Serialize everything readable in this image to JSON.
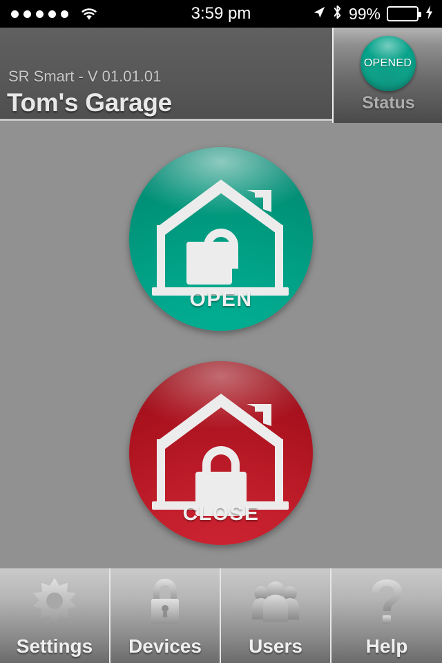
{
  "statusbar": {
    "signal_dots": 5,
    "wifi_icon": "wifi-icon",
    "time": "3:59 pm",
    "location_icon": "location-arrow-icon",
    "bluetooth_icon": "bluetooth-icon",
    "battery_percent": "99%",
    "battery_color": "#3ddb52",
    "charging_icon": "lightning-bolt-icon"
  },
  "header": {
    "version": "SR Smart - V 01.01.01",
    "title": "Tom's Garage",
    "status": {
      "orb_text": "OPENED",
      "label": "Status",
      "orb_color": "#00a58c"
    }
  },
  "main": {
    "buttons": [
      {
        "id": "open",
        "caption": "OPEN",
        "icon": "house-with-open-padlock-icon",
        "color": "#01a78c"
      },
      {
        "id": "close",
        "caption": "CLOSE",
        "icon": "house-with-closed-padlock-icon",
        "color": "#c31f2c"
      }
    ]
  },
  "tabbar": {
    "items": [
      {
        "label": "Settings",
        "icon": "gear-icon"
      },
      {
        "label": "Devices",
        "icon": "padlock-icon"
      },
      {
        "label": "Users",
        "icon": "users-group-icon"
      },
      {
        "label": "Help",
        "icon": "question-mark-icon"
      }
    ]
  }
}
